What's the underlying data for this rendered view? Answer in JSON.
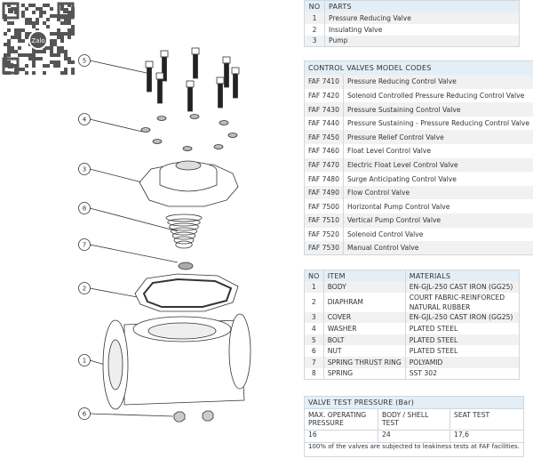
{
  "qr": {
    "logo_text": "Zalo"
  },
  "parts": {
    "headers": [
      "NO",
      "PARTS"
    ],
    "rows": [
      [
        "1",
        "Pressure Reducing Valve"
      ],
      [
        "2",
        "Insulating Valve"
      ],
      [
        "3",
        "Pump"
      ]
    ]
  },
  "codes": {
    "title": "CONTROL VALVES MODEL CODES",
    "rows": [
      [
        "FAF 7410",
        "Pressure Reducing Control Valve"
      ],
      [
        "FAF 7420",
        "Solenoid Controlled Pressure Reducing Control Valve"
      ],
      [
        "FAF 7430",
        "Pressure Sustaining Control Valve"
      ],
      [
        "FAF 7440",
        "Pressure Sustaining - Pressure Reducing Control Valve"
      ],
      [
        "FAF 7450",
        "Pressure Relief Control Valve"
      ],
      [
        "FAF 7460",
        "Float Level Control Valve"
      ],
      [
        "FAF 7470",
        "Electric Float Level Control Valve"
      ],
      [
        "FAF 7480",
        "Surge Anticipating Control Valve"
      ],
      [
        "FAF 7490",
        "Flow Control Valve"
      ],
      [
        "FAF 7500",
        "Horizontal Pump Control Valve"
      ],
      [
        "FAF 7510",
        "Vertical Pump Control Valve"
      ],
      [
        "FAF 7520",
        "Solenoid Control Valve"
      ],
      [
        "FAF 7530",
        "Manual Control Valve"
      ]
    ]
  },
  "materials": {
    "headers": [
      "NO",
      "ITEM",
      "MATERIALS"
    ],
    "rows": [
      [
        "1",
        "BODY",
        "EN-GJL-250 CAST IRON (GG25)"
      ],
      [
        "2",
        "DIAPHRAM",
        "COURT FABRIC-REINFORCED NATURAL RUBBER"
      ],
      [
        "3",
        "COVER",
        "EN-GJL-250 CAST IRON (GG25)"
      ],
      [
        "4",
        "WASHER",
        "PLATED STEEL"
      ],
      [
        "5",
        "BOLT",
        "PLATED STEEL"
      ],
      [
        "6",
        "NUT",
        "PLATED STEEL"
      ],
      [
        "7",
        "SPRING THRUST RING",
        "POLYAMID"
      ],
      [
        "8",
        "SPRING",
        "SST 302"
      ]
    ]
  },
  "test": {
    "title": "VALVE TEST PRESSURE (Bar)",
    "headers": [
      "MAX. OPERATING PRESSURE",
      "BODY / SHELL TEST",
      "SEAT TEST"
    ],
    "values": [
      "16",
      "24",
      "17,6"
    ],
    "note": "100% of the valves are subjected to leakiness tests at FAF facilities."
  },
  "callouts": [
    "5",
    "4",
    "3",
    "8",
    "7",
    "2",
    "1",
    "6"
  ]
}
